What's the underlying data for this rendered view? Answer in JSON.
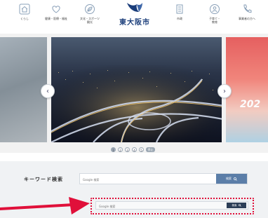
{
  "nav": {
    "items": [
      {
        "label": "くらし",
        "icon": "house-icon"
      },
      {
        "label": "健康・医療・福祉",
        "icon": "heart-icon"
      },
      {
        "label": "文化・スポーツ\n観光",
        "icon": "leaf-icon"
      },
      {
        "label": "市政",
        "icon": "building-icon"
      },
      {
        "label": "子育て・\n教育",
        "icon": "child-icon"
      },
      {
        "label": "事業者の方へ",
        "icon": "phone-icon"
      }
    ],
    "logo_text": "東大阪市"
  },
  "carousel": {
    "right_slide_text": "202",
    "dots": [
      "1",
      "2",
      "3",
      "4",
      "5"
    ],
    "pause_label": "停止",
    "active_dot_index": 0
  },
  "search": {
    "label": "キーワード検索",
    "placeholder": "Google 検索",
    "button_label": "検索",
    "secondary_placeholder": "Google 検索",
    "secondary_button_label": "検索"
  },
  "colors": {
    "accent_blue": "#5b7ea8",
    "dark_button": "#2c3e57",
    "annotation_red": "#e0103a",
    "logo_blue": "#1a3d7a"
  }
}
